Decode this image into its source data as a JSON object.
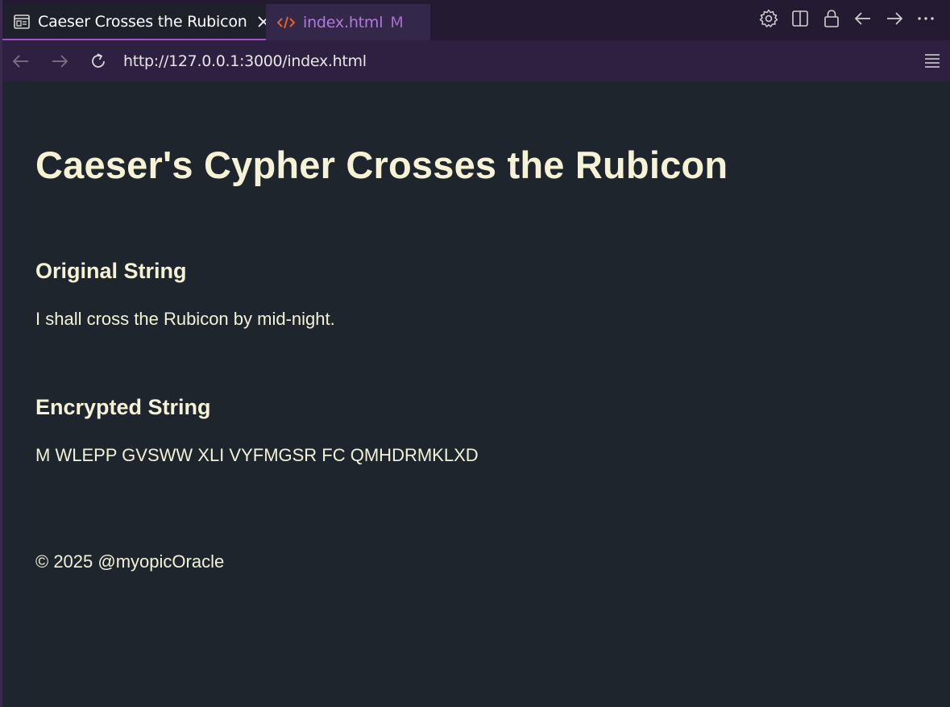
{
  "tabs": [
    {
      "label": "Caeser Crosses the Rubicon",
      "active": true
    },
    {
      "label": "index.html",
      "badge": "M",
      "active": false
    }
  ],
  "address": {
    "url": "http://127.0.0.1:3000/index.html"
  },
  "page": {
    "title": "Caeser's Cypher Crosses the Rubicon",
    "original_heading": "Original String",
    "original_text": "I shall cross the Rubicon by mid-night.",
    "encrypted_heading": "Encrypted String",
    "encrypted_text": "M WLEPP GVSWW XLI VYFMGSR FC QMHDRMKLXD",
    "footer": "© 2025 @myopicOracle"
  },
  "colors": {
    "background": "#1f252c",
    "text": "#f5f2d6",
    "tabbar": "#241b32",
    "addressbar": "#2e2040",
    "accent": "#a350c9",
    "html_icon": "#e8622a"
  },
  "icons": {
    "tab1": "preview-icon",
    "tab2": "code-icon",
    "actions": [
      "gear-icon",
      "split-editor-icon",
      "lock-icon",
      "arrow-left-icon",
      "arrow-right-icon",
      "more-icon"
    ],
    "nav": [
      "back-icon",
      "forward-icon",
      "reload-icon",
      "menu-icon"
    ]
  }
}
